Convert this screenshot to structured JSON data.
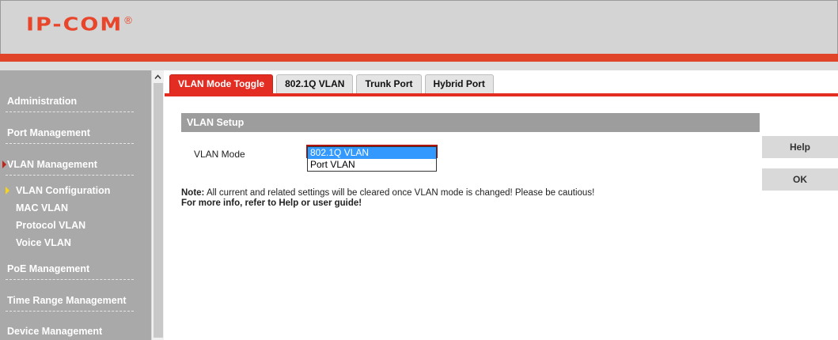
{
  "header": {
    "logo_text": "IP-COM",
    "logo_mark": "®",
    "brand_color": "#e8452a"
  },
  "sidebar": {
    "sections": [
      {
        "label": "Administration"
      },
      {
        "label": "Port Management"
      },
      {
        "label": "VLAN Management",
        "active": true
      },
      {
        "label": "PoE Management"
      },
      {
        "label": "Time Range Management"
      },
      {
        "label": "Device Management"
      }
    ],
    "vlan_items": [
      {
        "label": "VLAN Configuration",
        "active": true
      },
      {
        "label": "MAC VLAN"
      },
      {
        "label": "Protocol VLAN"
      },
      {
        "label": "Voice VLAN"
      }
    ]
  },
  "tabs": [
    {
      "label": "VLAN Mode Toggle",
      "active": true
    },
    {
      "label": "802.1Q VLAN"
    },
    {
      "label": "Trunk Port"
    },
    {
      "label": "Hybrid Port"
    }
  ],
  "main": {
    "section_title": "VLAN Setup",
    "vlan_mode_label": "VLAN Mode",
    "vlan_mode_options": [
      "802.1Q VLAN",
      "Port VLAN"
    ],
    "vlan_mode_selected": "802.1Q VLAN",
    "note_prefix": "Note:",
    "note_text": " All current and related settings will be cleared once VLAN mode is changed! Please be cautious!",
    "more_info": "For more info, refer to Help or user guide!"
  },
  "buttons": {
    "help_label": "Help",
    "ok_label": "OK"
  },
  "colors": {
    "accent_red": "#e32d23",
    "sidebar_gray": "#a9a9a9",
    "selection_blue": "#3399ff"
  }
}
